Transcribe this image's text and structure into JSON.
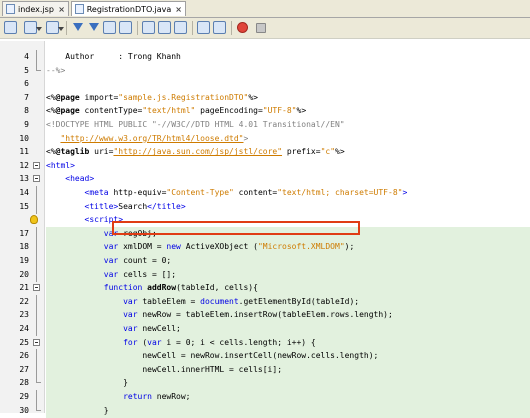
{
  "tabs": [
    {
      "label": "index.jsp",
      "active": false
    },
    {
      "label": "RegistrationDTO.java",
      "active": true
    }
  ],
  "toolbar": {
    "buttons": [
      "history-icon",
      "back-icon",
      "forward-icon",
      "find-previous-icon",
      "find-next-icon",
      "find-selection-icon",
      "toggle-highlight-icon",
      "prev-bookmark-icon",
      "next-bookmark-icon",
      "shift-left-icon",
      "shift-right-icon",
      "record-macro-icon",
      "stop-macro-icon"
    ]
  },
  "editor": {
    "lines": [
      {
        "n": "4",
        "hl": false,
        "gutter": "fline",
        "toks": [
          [
            "t-plain",
            "    Author     : Trong Khanh"
          ]
        ]
      },
      {
        "n": "5",
        "hl": false,
        "gutter": "fend",
        "toks": [
          [
            "t-cmt",
            "--%>"
          ]
        ]
      },
      {
        "n": "6",
        "hl": false,
        "gutter": "",
        "toks": []
      },
      {
        "n": "7",
        "hl": false,
        "gutter": "",
        "toks": [
          [
            "t-plain",
            "<%"
          ],
          [
            "t-dir",
            "@page"
          ],
          [
            "t-plain",
            " import="
          ],
          [
            "t-str",
            "\"sample.js.RegistrationDTO\""
          ],
          [
            "t-plain",
            "%>"
          ]
        ]
      },
      {
        "n": "8",
        "hl": false,
        "gutter": "",
        "toks": [
          [
            "t-plain",
            "<%"
          ],
          [
            "t-dir",
            "@page"
          ],
          [
            "t-plain",
            " contentType="
          ],
          [
            "t-str",
            "\"text/html\""
          ],
          [
            "t-plain",
            " pageEncoding="
          ],
          [
            "t-str",
            "\"UTF-8\""
          ],
          [
            "t-plain",
            "%>"
          ]
        ]
      },
      {
        "n": "9",
        "hl": false,
        "gutter": "",
        "toks": [
          [
            "t-cmt",
            "<!DOCTYPE HTML PUBLIC \"-//W3C//DTD HTML 4.01 Transitional//EN\""
          ]
        ]
      },
      {
        "n": "10",
        "hl": false,
        "gutter": "",
        "toks": [
          [
            "t-plain",
            "   "
          ],
          [
            "t-url",
            "\"http://www.w3.org/TR/html4/loose.dtd\""
          ],
          [
            "t-cmt",
            ">"
          ]
        ]
      },
      {
        "n": "11",
        "hl": false,
        "gutter": "",
        "toks": [
          [
            "t-plain",
            "<%"
          ],
          [
            "t-dir",
            "@taglib"
          ],
          [
            "t-plain",
            " uri="
          ],
          [
            "t-url",
            "\"http://java.sun.com/jsp/jstl/core\""
          ],
          [
            "t-plain",
            " prefix="
          ],
          [
            "t-str",
            "\"c\""
          ],
          [
            "t-plain",
            "%>"
          ]
        ]
      },
      {
        "n": "12",
        "hl": false,
        "gutter": "fold",
        "toks": [
          [
            "t-tag",
            "<html>"
          ]
        ]
      },
      {
        "n": "13",
        "hl": false,
        "gutter": "fold",
        "toks": [
          [
            "t-plain",
            "    "
          ],
          [
            "t-tag",
            "<head>"
          ]
        ]
      },
      {
        "n": "14",
        "hl": false,
        "gutter": "fline",
        "toks": [
          [
            "t-plain",
            "        "
          ],
          [
            "t-tag",
            "<meta"
          ],
          [
            "t-plain",
            " http-equiv="
          ],
          [
            "t-str",
            "\"Content-Type\""
          ],
          [
            "t-plain",
            " content="
          ],
          [
            "t-str",
            "\"text/html; charset=UTF-8\""
          ],
          [
            "t-tag",
            ">"
          ]
        ]
      },
      {
        "n": "15",
        "hl": false,
        "gutter": "fline",
        "toks": [
          [
            "t-plain",
            "        "
          ],
          [
            "t-tag",
            "<title>"
          ],
          [
            "t-plain",
            "Search"
          ],
          [
            "t-tag",
            "</title>"
          ]
        ]
      },
      {
        "n": "",
        "hl": false,
        "gutter": "bulb",
        "toks": [
          [
            "t-plain",
            "        "
          ],
          [
            "t-tag",
            "<script>"
          ]
        ]
      },
      {
        "n": "17",
        "hl": true,
        "gutter": "fline",
        "toks": [
          [
            "t-plain",
            "            "
          ],
          [
            "t-kw",
            "var"
          ],
          [
            "t-plain",
            " regObj;"
          ]
        ]
      },
      {
        "n": "18",
        "hl": true,
        "gutter": "fline",
        "toks": [
          [
            "t-plain",
            "            "
          ],
          [
            "t-kw",
            "var"
          ],
          [
            "t-plain",
            " xmlDOM = "
          ],
          [
            "t-kw",
            "new"
          ],
          [
            "t-plain",
            " ActiveXObject ("
          ],
          [
            "t-str",
            "\"Microsoft.XMLDOM\""
          ],
          [
            "t-plain",
            ");"
          ]
        ]
      },
      {
        "n": "19",
        "hl": true,
        "gutter": "fline",
        "toks": [
          [
            "t-plain",
            "            "
          ],
          [
            "t-kw",
            "var"
          ],
          [
            "t-plain",
            " count = 0;"
          ]
        ]
      },
      {
        "n": "20",
        "hl": true,
        "gutter": "fline",
        "toks": [
          [
            "t-plain",
            "            "
          ],
          [
            "t-kw",
            "var"
          ],
          [
            "t-plain",
            " cells = [];"
          ]
        ]
      },
      {
        "n": "21",
        "hl": true,
        "gutter": "fold",
        "toks": [
          [
            "t-plain",
            "            "
          ],
          [
            "t-kw",
            "function"
          ],
          [
            "t-plain",
            " "
          ],
          [
            "t-fn",
            "addRow"
          ],
          [
            "t-plain",
            "(tableId, cells){"
          ]
        ]
      },
      {
        "n": "22",
        "hl": true,
        "gutter": "fline",
        "toks": [
          [
            "t-plain",
            "                "
          ],
          [
            "t-kw",
            "var"
          ],
          [
            "t-plain",
            " tableElem = "
          ],
          [
            "t-kw",
            "document"
          ],
          [
            "t-plain",
            ".getElementById(tableId);"
          ]
        ]
      },
      {
        "n": "23",
        "hl": true,
        "gutter": "fline",
        "toks": [
          [
            "t-plain",
            "                "
          ],
          [
            "t-kw",
            "var"
          ],
          [
            "t-plain",
            " newRow = tableElem.insertRow(tableElem.rows.length);"
          ]
        ]
      },
      {
        "n": "24",
        "hl": true,
        "gutter": "fline",
        "toks": [
          [
            "t-plain",
            "                "
          ],
          [
            "t-kw",
            "var"
          ],
          [
            "t-plain",
            " newCell;"
          ]
        ]
      },
      {
        "n": "25",
        "hl": true,
        "gutter": "fold",
        "toks": [
          [
            "t-plain",
            "                "
          ],
          [
            "t-kw",
            "for"
          ],
          [
            "t-plain",
            " ("
          ],
          [
            "t-kw",
            "var"
          ],
          [
            "t-plain",
            " i = 0; i < cells.length; i++) {"
          ]
        ]
      },
      {
        "n": "26",
        "hl": true,
        "gutter": "fline",
        "toks": [
          [
            "t-plain",
            "                    newCell = newRow.insertCell(newRow.cells.length);"
          ]
        ]
      },
      {
        "n": "27",
        "hl": true,
        "gutter": "fline",
        "toks": [
          [
            "t-plain",
            "                    newCell.innerHTML = cells[i];"
          ]
        ]
      },
      {
        "n": "28",
        "hl": true,
        "gutter": "fend",
        "toks": [
          [
            "t-plain",
            "                }"
          ]
        ]
      },
      {
        "n": "29",
        "hl": true,
        "gutter": "fline",
        "toks": [
          [
            "t-plain",
            "                "
          ],
          [
            "t-kw",
            "return"
          ],
          [
            "t-plain",
            " newRow;"
          ]
        ]
      },
      {
        "n": "30",
        "hl": true,
        "gutter": "fend",
        "toks": [
          [
            "t-plain",
            "            }"
          ]
        ]
      }
    ]
  },
  "colors": {
    "highlight_bg": "#e2f1de",
    "annotation_box": "#e03c14"
  }
}
